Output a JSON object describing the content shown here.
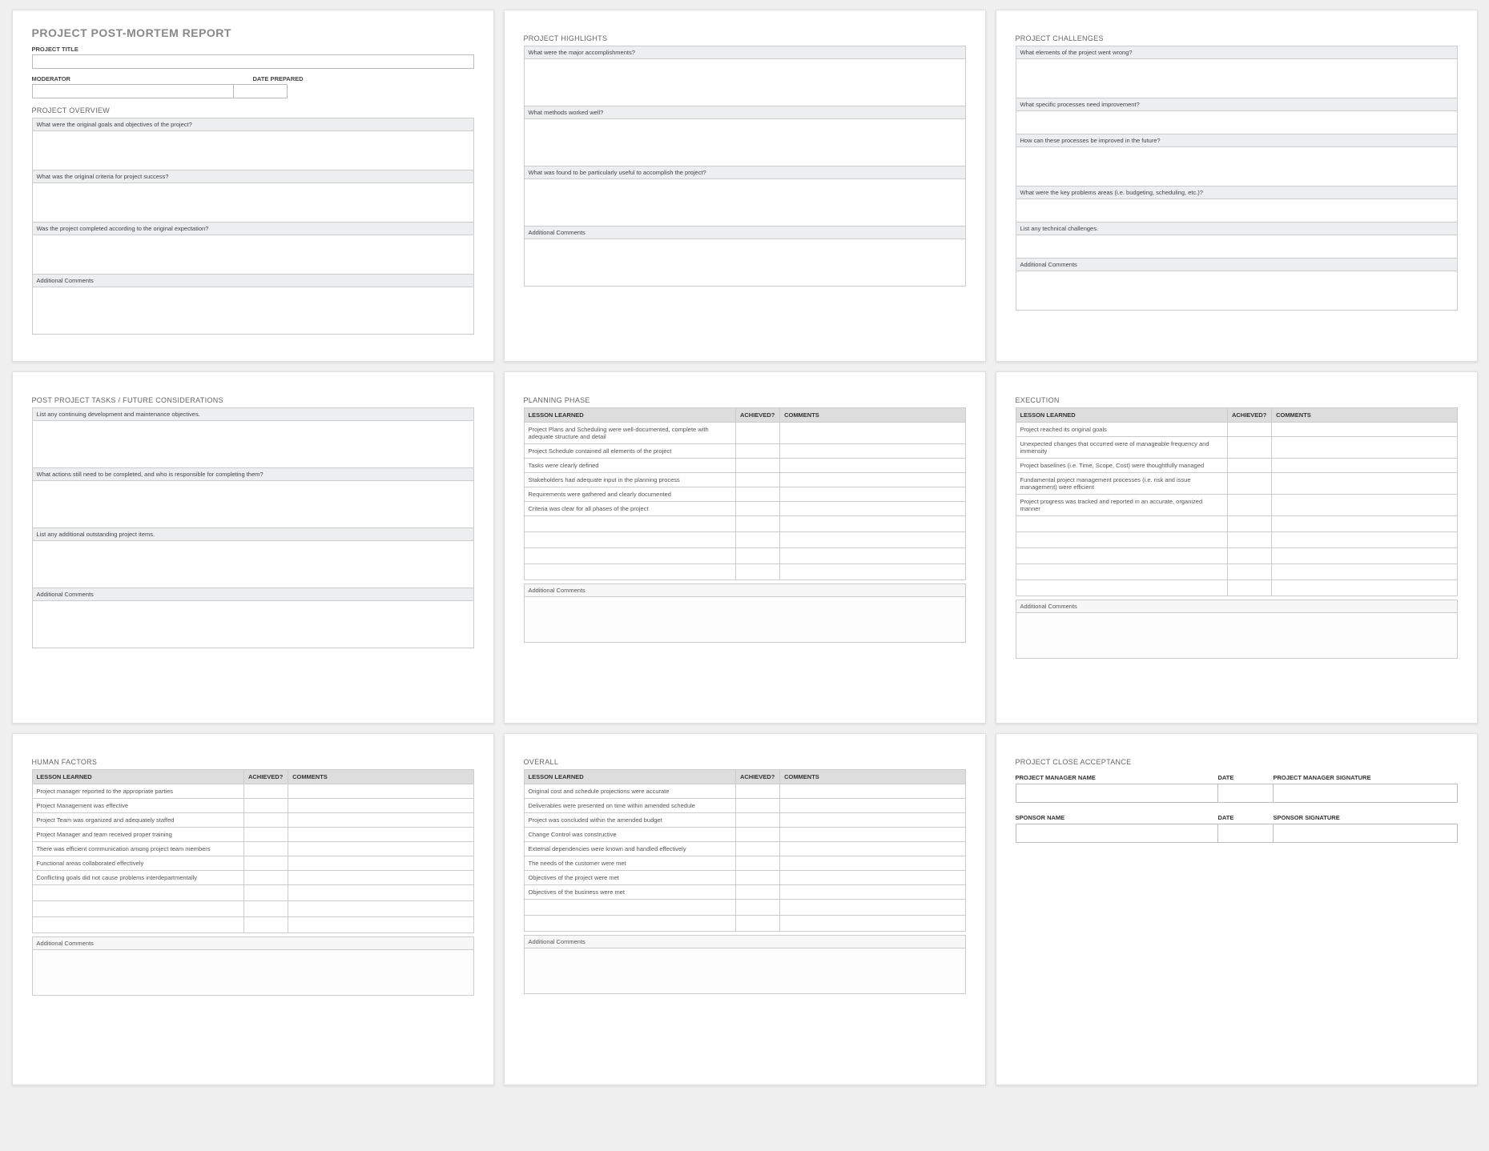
{
  "card1": {
    "title": "PROJECT POST-MORTEM REPORT",
    "project_title_label": "PROJECT TITLE",
    "moderator_label": "MODERATOR",
    "date_prepared_label": "DATE PREPARED",
    "overview_heading": "PROJECT OVERVIEW",
    "q1": "What were the original goals and objectives of the project?",
    "q2": "What was the original criteria for project success?",
    "q3": "Was the project completed according to the original expectation?",
    "additional": "Additional Comments"
  },
  "card2": {
    "heading": "PROJECT HIGHLIGHTS",
    "q1": "What were the major accomplishments?",
    "q2": "What methods worked well?",
    "q3": "What was found to be particularly useful to accomplish the project?",
    "additional": "Additional Comments"
  },
  "card3": {
    "heading": "PROJECT CHALLENGES",
    "q1": "What elements of the project went wrong?",
    "q2": "What specific processes need improvement?",
    "q3": "How can these processes be improved in the future?",
    "q4": "What were the key problems areas (i.e. budgeting, scheduling, etc.)?",
    "q5": "List any technical challenges.",
    "additional": "Additional Comments"
  },
  "card4": {
    "heading": "POST PROJECT TASKS / FUTURE CONSIDERATIONS",
    "q1": "List any continuing development and maintenance objectives.",
    "q2": "What actions still need to be completed, and who is responsible for completing them?",
    "q3": "List any additional outstanding project items.",
    "additional": "Additional Comments"
  },
  "card5": {
    "heading": "PLANNING PHASE",
    "th_lesson": "LESSON LEARNED",
    "th_achieved": "ACHIEVED?",
    "th_comments": "COMMENTS",
    "rows": [
      "Project Plans and Scheduling were well-documented, complete with adequate structure and detail",
      "Project Schedule contained all elements of the project",
      "Tasks were clearly defined",
      "Stakeholders had adequate input in the planning process",
      "Requirements were gathered and clearly documented",
      "Criteria was clear for all phases of the project"
    ],
    "additional": "Additional Comments"
  },
  "card6": {
    "heading": "EXECUTION",
    "th_lesson": "LESSON LEARNED",
    "th_achieved": "ACHIEVED?",
    "th_comments": "COMMENTS",
    "rows": [
      "Project reached its original goals",
      "Unexpected changes that occurred were of manageable frequency and immensity",
      "Project baselines (i.e. Time, Scope, Cost) were thoughtfully managed",
      "Fundamental project management processes (i.e. risk and issue management) were efficient",
      "Project progress was tracked and reported in an accurate, organized manner"
    ],
    "additional": "Additional Comments"
  },
  "card7": {
    "heading": "HUMAN FACTORS",
    "th_lesson": "LESSON LEARNED",
    "th_achieved": "ACHIEVED?",
    "th_comments": "COMMENTS",
    "rows": [
      "Project manager reported to the appropriate parties",
      "Project Management was effective",
      "Project Team was organized and adequately staffed",
      "Project Manager and team received proper training",
      "There was efficient communication among project team members",
      "Functional areas collaborated effectively",
      "Conflicting goals did not cause problems interdepartmentally"
    ],
    "additional": "Additional Comments"
  },
  "card8": {
    "heading": "OVERALL",
    "th_lesson": "LESSON LEARNED",
    "th_achieved": "ACHIEVED?",
    "th_comments": "COMMENTS",
    "rows": [
      "Original cost and schedule projections were accurate",
      "Deliverables were presented on time within amended schedule",
      "Project was concluded within the amended budget",
      "Change Control was constructive",
      "External dependencies were known and handled effectively",
      "The needs of the customer were met",
      "Objectives of the project were met",
      "Objectives of the business were met"
    ],
    "additional": "Additional Comments"
  },
  "card9": {
    "heading": "PROJECT CLOSE ACCEPTANCE",
    "pm_name": "PROJECT MANAGER NAME",
    "date": "DATE",
    "pm_sig": "PROJECT MANAGER SIGNATURE",
    "sponsor_name": "SPONSOR NAME",
    "sponsor_sig": "SPONSOR SIGNATURE"
  }
}
